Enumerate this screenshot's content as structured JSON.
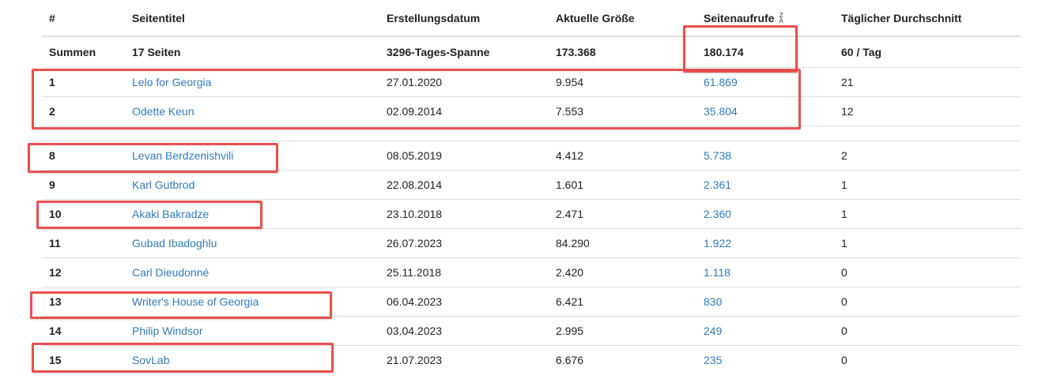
{
  "headers": {
    "num": "#",
    "title": "Seitentitel",
    "created": "Erstellungsdatum",
    "size": "Aktuelle Größe",
    "views": "Seitenaufrufe",
    "daily": "Täglicher Durchschnitt",
    "sort_glyph_top": "Z",
    "sort_glyph_bottom": "A"
  },
  "totals": {
    "label": "Summen",
    "pages": "17 Seiten",
    "span": "3296-Tages-Spanne",
    "size": "173.368",
    "views": "180.174",
    "daily": "60 / Tag"
  },
  "rows_top": [
    {
      "num": "1",
      "title": "Lelo for Georgia",
      "created": "27.01.2020",
      "size": "9.954",
      "views": "61.869",
      "daily": "21"
    },
    {
      "num": "2",
      "title": "Odette Keun",
      "created": "02.09.2014",
      "size": "7.553",
      "views": "35.804",
      "daily": "12"
    }
  ],
  "rows_bottom": [
    {
      "num": "8",
      "title": "Levan Berdzenishvili",
      "created": "08.05.2019",
      "size": "4.412",
      "views": "5.738",
      "daily": "2"
    },
    {
      "num": "9",
      "title": "Karl Gutbrod",
      "created": "22.08.2014",
      "size": "1.601",
      "views": "2.361",
      "daily": "1"
    },
    {
      "num": "10",
      "title": "Akaki Bakradze",
      "created": "23.10.2018",
      "size": "2.471",
      "views": "2.360",
      "daily": "1"
    },
    {
      "num": "11",
      "title": "Gubad Ibadoghlu",
      "created": "26.07.2023",
      "size": "84.290",
      "views": "1.922",
      "daily": "1"
    },
    {
      "num": "12",
      "title": "Carl Dieudonné",
      "created": "25.11.2018",
      "size": "2.420",
      "views": "1.118",
      "daily": "0"
    },
    {
      "num": "13",
      "title": "Writer's House of Georgia",
      "created": "06.04.2023",
      "size": "6.421",
      "views": "830",
      "daily": "0"
    },
    {
      "num": "14",
      "title": "Philip Windsor",
      "created": "03.04.2023",
      "size": "2.995",
      "views": "249",
      "daily": "0"
    },
    {
      "num": "15",
      "title": "SovLab",
      "created": "21.07.2023",
      "size": "6.676",
      "views": "235",
      "daily": "0"
    }
  ],
  "colors": {
    "link": "#337ab7",
    "highlight": "#e85050",
    "border": "#dddddd"
  }
}
